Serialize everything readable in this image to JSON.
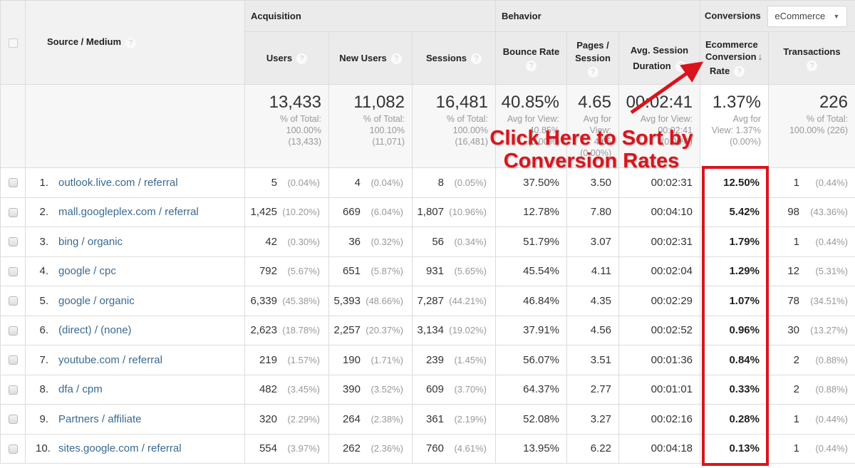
{
  "header": {
    "source_medium": "Source / Medium",
    "groups": {
      "acquisition": "Acquisition",
      "behavior": "Behavior",
      "conversions": "Conversions"
    },
    "conversion_select": {
      "value": "eCommerce"
    },
    "columns": {
      "users": "Users",
      "new_users": "New Users",
      "sessions": "Sessions",
      "bounce_rate": "Bounce Rate",
      "pages_session": "Pages / Session",
      "avg_duration_1": "Avg. Session",
      "avg_duration_2": "Duration",
      "ecr_1": "Ecommerce",
      "ecr_2": "Conversion",
      "ecr_3": "Rate",
      "transactions": "Transactions"
    },
    "help_glyph": "?",
    "sort_glyph": "↓",
    "select_caret": "▼"
  },
  "summary": {
    "users": {
      "value": "13,433",
      "l1": "% of Total:",
      "l2": "100.00%",
      "l3": "(13,433)"
    },
    "new_users": {
      "value": "11,082",
      "l1": "% of Total:",
      "l2": "100.10%",
      "l3": "(11,071)"
    },
    "sessions": {
      "value": "16,481",
      "l1": "% of Total:",
      "l2": "100.00%",
      "l3": "(16,481)"
    },
    "bounce_rate": {
      "value": "40.85%",
      "l1": "Avg for View:",
      "l2": "40.85%",
      "l3": "(0.00%)"
    },
    "pages_session": {
      "value": "4.65",
      "l1": "Avg for",
      "l2": "View:",
      "l3": "4.65",
      "l4": "(0.00%)"
    },
    "avg_duration": {
      "value": "00:02:41",
      "l1": "Avg for View:",
      "l2": "00:02:41",
      "l3": "(0.00%)"
    },
    "ecr": {
      "value": "1.37%",
      "l1": "Avg for",
      "l2": "View: 1.37%",
      "l3": "(0.00%)"
    },
    "transactions": {
      "value": "226",
      "l1": "% of Total:",
      "l2": "100.00% (226)"
    }
  },
  "rows": [
    {
      "idx": "1.",
      "source": "outlook.live.com / referral",
      "users": "5",
      "users_pct": "(0.04%)",
      "new_users": "4",
      "new_users_pct": "(0.04%)",
      "sessions": "8",
      "sessions_pct": "(0.05%)",
      "bounce": "37.50%",
      "pages": "3.50",
      "duration": "00:02:31",
      "ecr": "12.50%",
      "trans": "1",
      "trans_pct": "(0.44%)"
    },
    {
      "idx": "2.",
      "source": "mall.googleplex.com / referral",
      "users": "1,425",
      "users_pct": "(10.20%)",
      "new_users": "669",
      "new_users_pct": "(6.04%)",
      "sessions": "1,807",
      "sessions_pct": "(10.96%)",
      "bounce": "12.78%",
      "pages": "7.80",
      "duration": "00:04:10",
      "ecr": "5.42%",
      "trans": "98",
      "trans_pct": "(43.36%)"
    },
    {
      "idx": "3.",
      "source": "bing / organic",
      "users": "42",
      "users_pct": "(0.30%)",
      "new_users": "36",
      "new_users_pct": "(0.32%)",
      "sessions": "56",
      "sessions_pct": "(0.34%)",
      "bounce": "51.79%",
      "pages": "3.07",
      "duration": "00:02:31",
      "ecr": "1.79%",
      "trans": "1",
      "trans_pct": "(0.44%)"
    },
    {
      "idx": "4.",
      "source": "google / cpc",
      "users": "792",
      "users_pct": "(5.67%)",
      "new_users": "651",
      "new_users_pct": "(5.87%)",
      "sessions": "931",
      "sessions_pct": "(5.65%)",
      "bounce": "45.54%",
      "pages": "4.11",
      "duration": "00:02:04",
      "ecr": "1.29%",
      "trans": "12",
      "trans_pct": "(5.31%)"
    },
    {
      "idx": "5.",
      "source": "google / organic",
      "users": "6,339",
      "users_pct": "(45.38%)",
      "new_users": "5,393",
      "new_users_pct": "(48.66%)",
      "sessions": "7,287",
      "sessions_pct": "(44.21%)",
      "bounce": "46.84%",
      "pages": "4.35",
      "duration": "00:02:29",
      "ecr": "1.07%",
      "trans": "78",
      "trans_pct": "(34.51%)"
    },
    {
      "idx": "6.",
      "source": "(direct) / (none)",
      "users": "2,623",
      "users_pct": "(18.78%)",
      "new_users": "2,257",
      "new_users_pct": "(20.37%)",
      "sessions": "3,134",
      "sessions_pct": "(19.02%)",
      "bounce": "37.91%",
      "pages": "4.56",
      "duration": "00:02:52",
      "ecr": "0.96%",
      "trans": "30",
      "trans_pct": "(13.27%)"
    },
    {
      "idx": "7.",
      "source": "youtube.com / referral",
      "users": "219",
      "users_pct": "(1.57%)",
      "new_users": "190",
      "new_users_pct": "(1.71%)",
      "sessions": "239",
      "sessions_pct": "(1.45%)",
      "bounce": "56.07%",
      "pages": "3.51",
      "duration": "00:01:36",
      "ecr": "0.84%",
      "trans": "2",
      "trans_pct": "(0.88%)"
    },
    {
      "idx": "8.",
      "source": "dfa / cpm",
      "users": "482",
      "users_pct": "(3.45%)",
      "new_users": "390",
      "new_users_pct": "(3.52%)",
      "sessions": "609",
      "sessions_pct": "(3.70%)",
      "bounce": "64.37%",
      "pages": "2.77",
      "duration": "00:01:01",
      "ecr": "0.33%",
      "trans": "2",
      "trans_pct": "(0.88%)"
    },
    {
      "idx": "9.",
      "source": "Partners / affiliate",
      "users": "320",
      "users_pct": "(2.29%)",
      "new_users": "264",
      "new_users_pct": "(2.38%)",
      "sessions": "361",
      "sessions_pct": "(2.19%)",
      "bounce": "52.08%",
      "pages": "3.27",
      "duration": "00:02:16",
      "ecr": "0.28%",
      "trans": "1",
      "trans_pct": "(0.44%)"
    },
    {
      "idx": "10.",
      "source": "sites.google.com / referral",
      "users": "554",
      "users_pct": "(3.97%)",
      "new_users": "262",
      "new_users_pct": "(2.36%)",
      "sessions": "760",
      "sessions_pct": "(4.61%)",
      "bounce": "13.95%",
      "pages": "6.22",
      "duration": "00:04:18",
      "ecr": "0.13%",
      "trans": "1",
      "trans_pct": "(0.44%)"
    }
  ],
  "annotation": {
    "line1": "Click Here to Sort by",
    "line2": "Conversion Rates",
    "color": "#d9141c"
  }
}
